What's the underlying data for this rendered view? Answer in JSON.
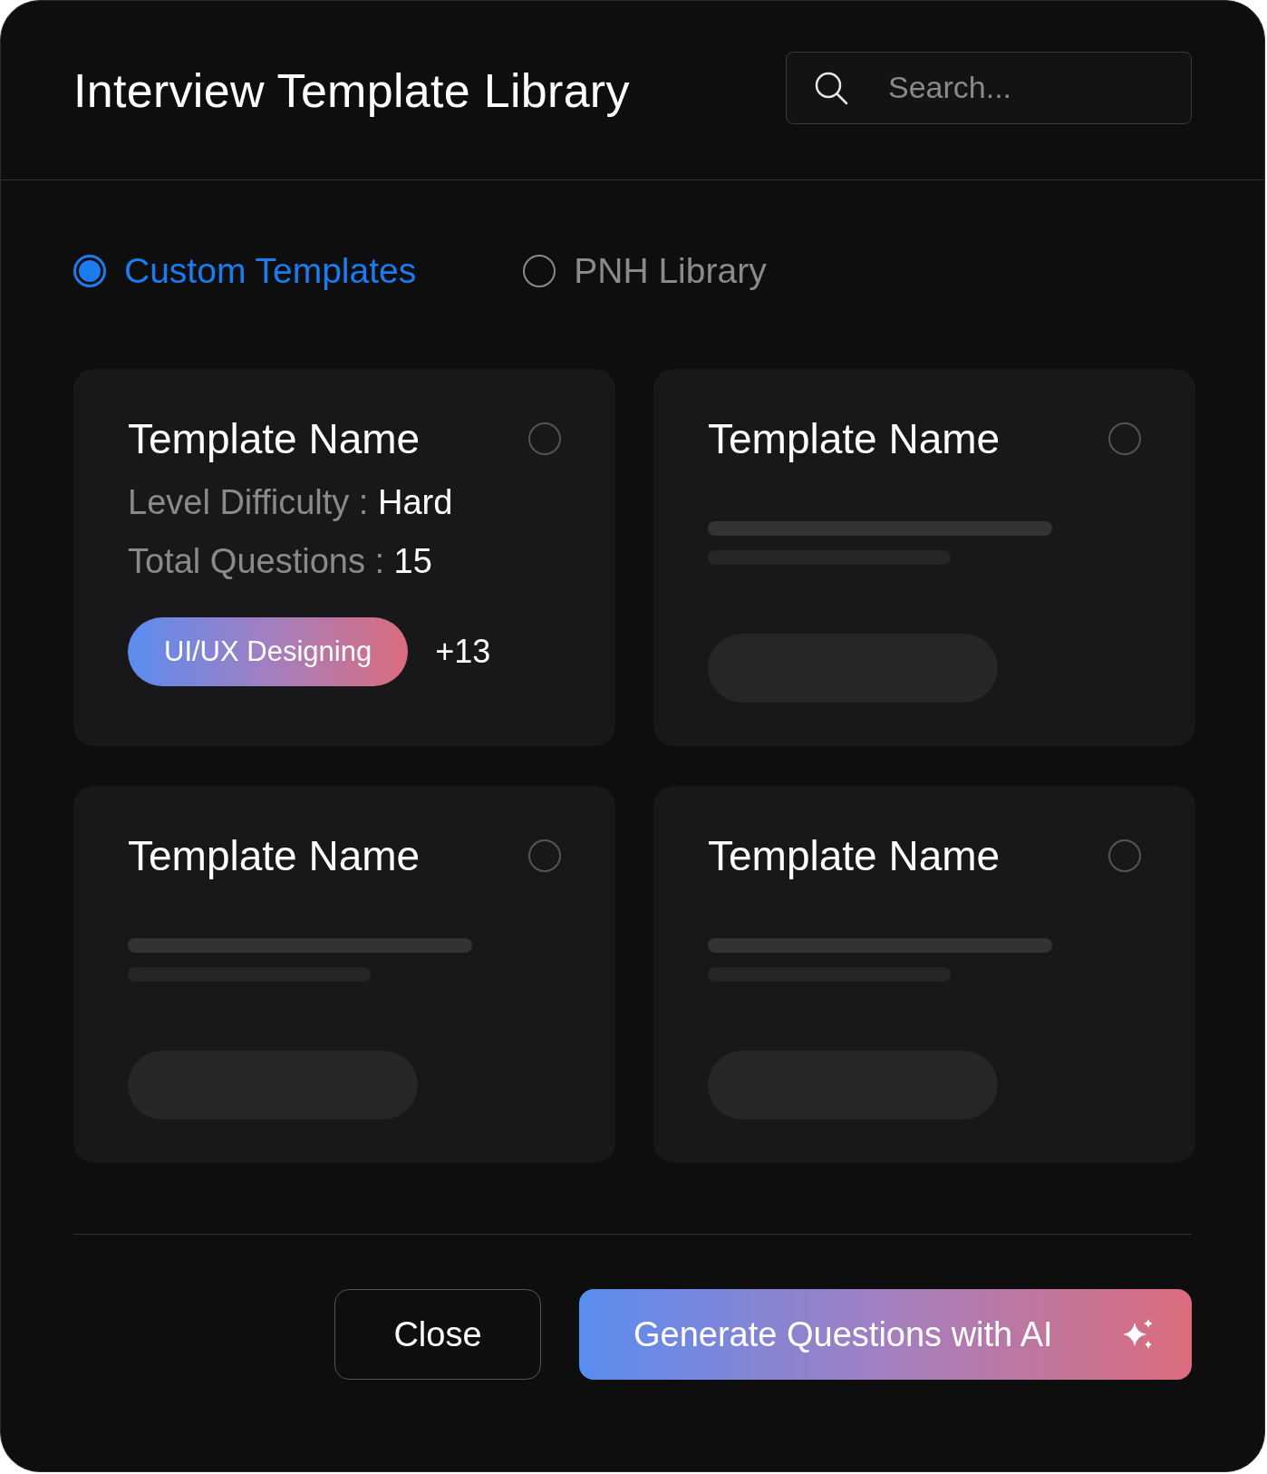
{
  "title": "Interview Template Library",
  "search": {
    "placeholder": "Search..."
  },
  "sources": [
    {
      "label": "Custom Templates",
      "selected": true
    },
    {
      "label": "PNH Library",
      "selected": false
    }
  ],
  "templates": [
    {
      "kind": "detail",
      "name": "Template Name",
      "selected": false,
      "difficulty_label": "Level Difficulty :",
      "difficulty": "Hard",
      "questions_label": "Total Questions :",
      "questions": "15",
      "tag": "UI/UX Designing",
      "more_tags": "+13"
    },
    {
      "kind": "skeleton",
      "name": "Template Name",
      "selected": false
    },
    {
      "kind": "skeleton",
      "name": "Template Name",
      "selected": false
    },
    {
      "kind": "skeleton",
      "name": "Template Name",
      "selected": false
    }
  ],
  "buttons": {
    "close": "Close",
    "generate": "Generate Questions with AI"
  }
}
